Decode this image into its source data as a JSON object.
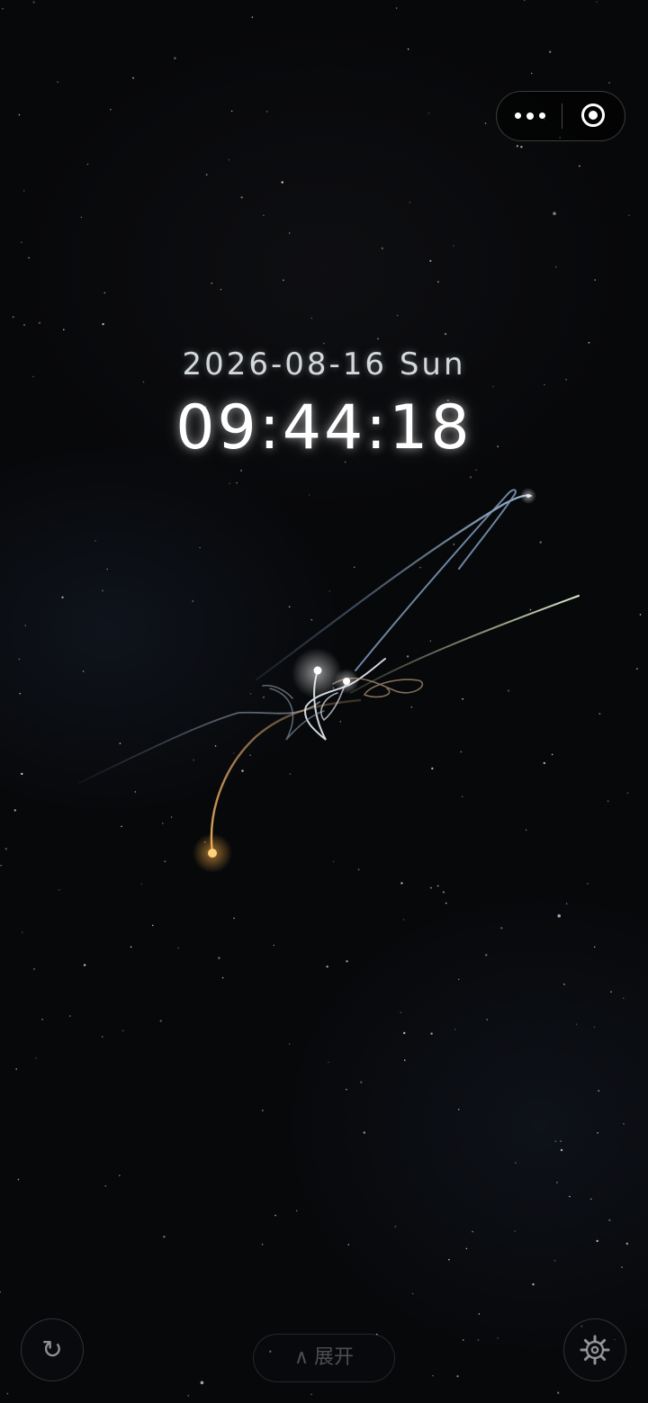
{
  "clock": {
    "date": "2026-08-16 Sun",
    "time": "09:44:18"
  },
  "capsule": {
    "more_icon": "more-dots-icon",
    "close_icon": "target-icon"
  },
  "controls": {
    "refresh_icon": "refresh-icon",
    "refresh_glyph": "↻",
    "expand_caret": "∧",
    "expand_label": "展开",
    "settings_icon": "gear-icon"
  },
  "colors": {
    "background": "#07080a",
    "trail_blue": "#9fb6cf",
    "trail_white": "#e8eef5",
    "trail_green": "#dbeec8",
    "trail_orange": "#e8b37a",
    "body_orange": "#ffd27a",
    "body_white": "#ffffff"
  }
}
